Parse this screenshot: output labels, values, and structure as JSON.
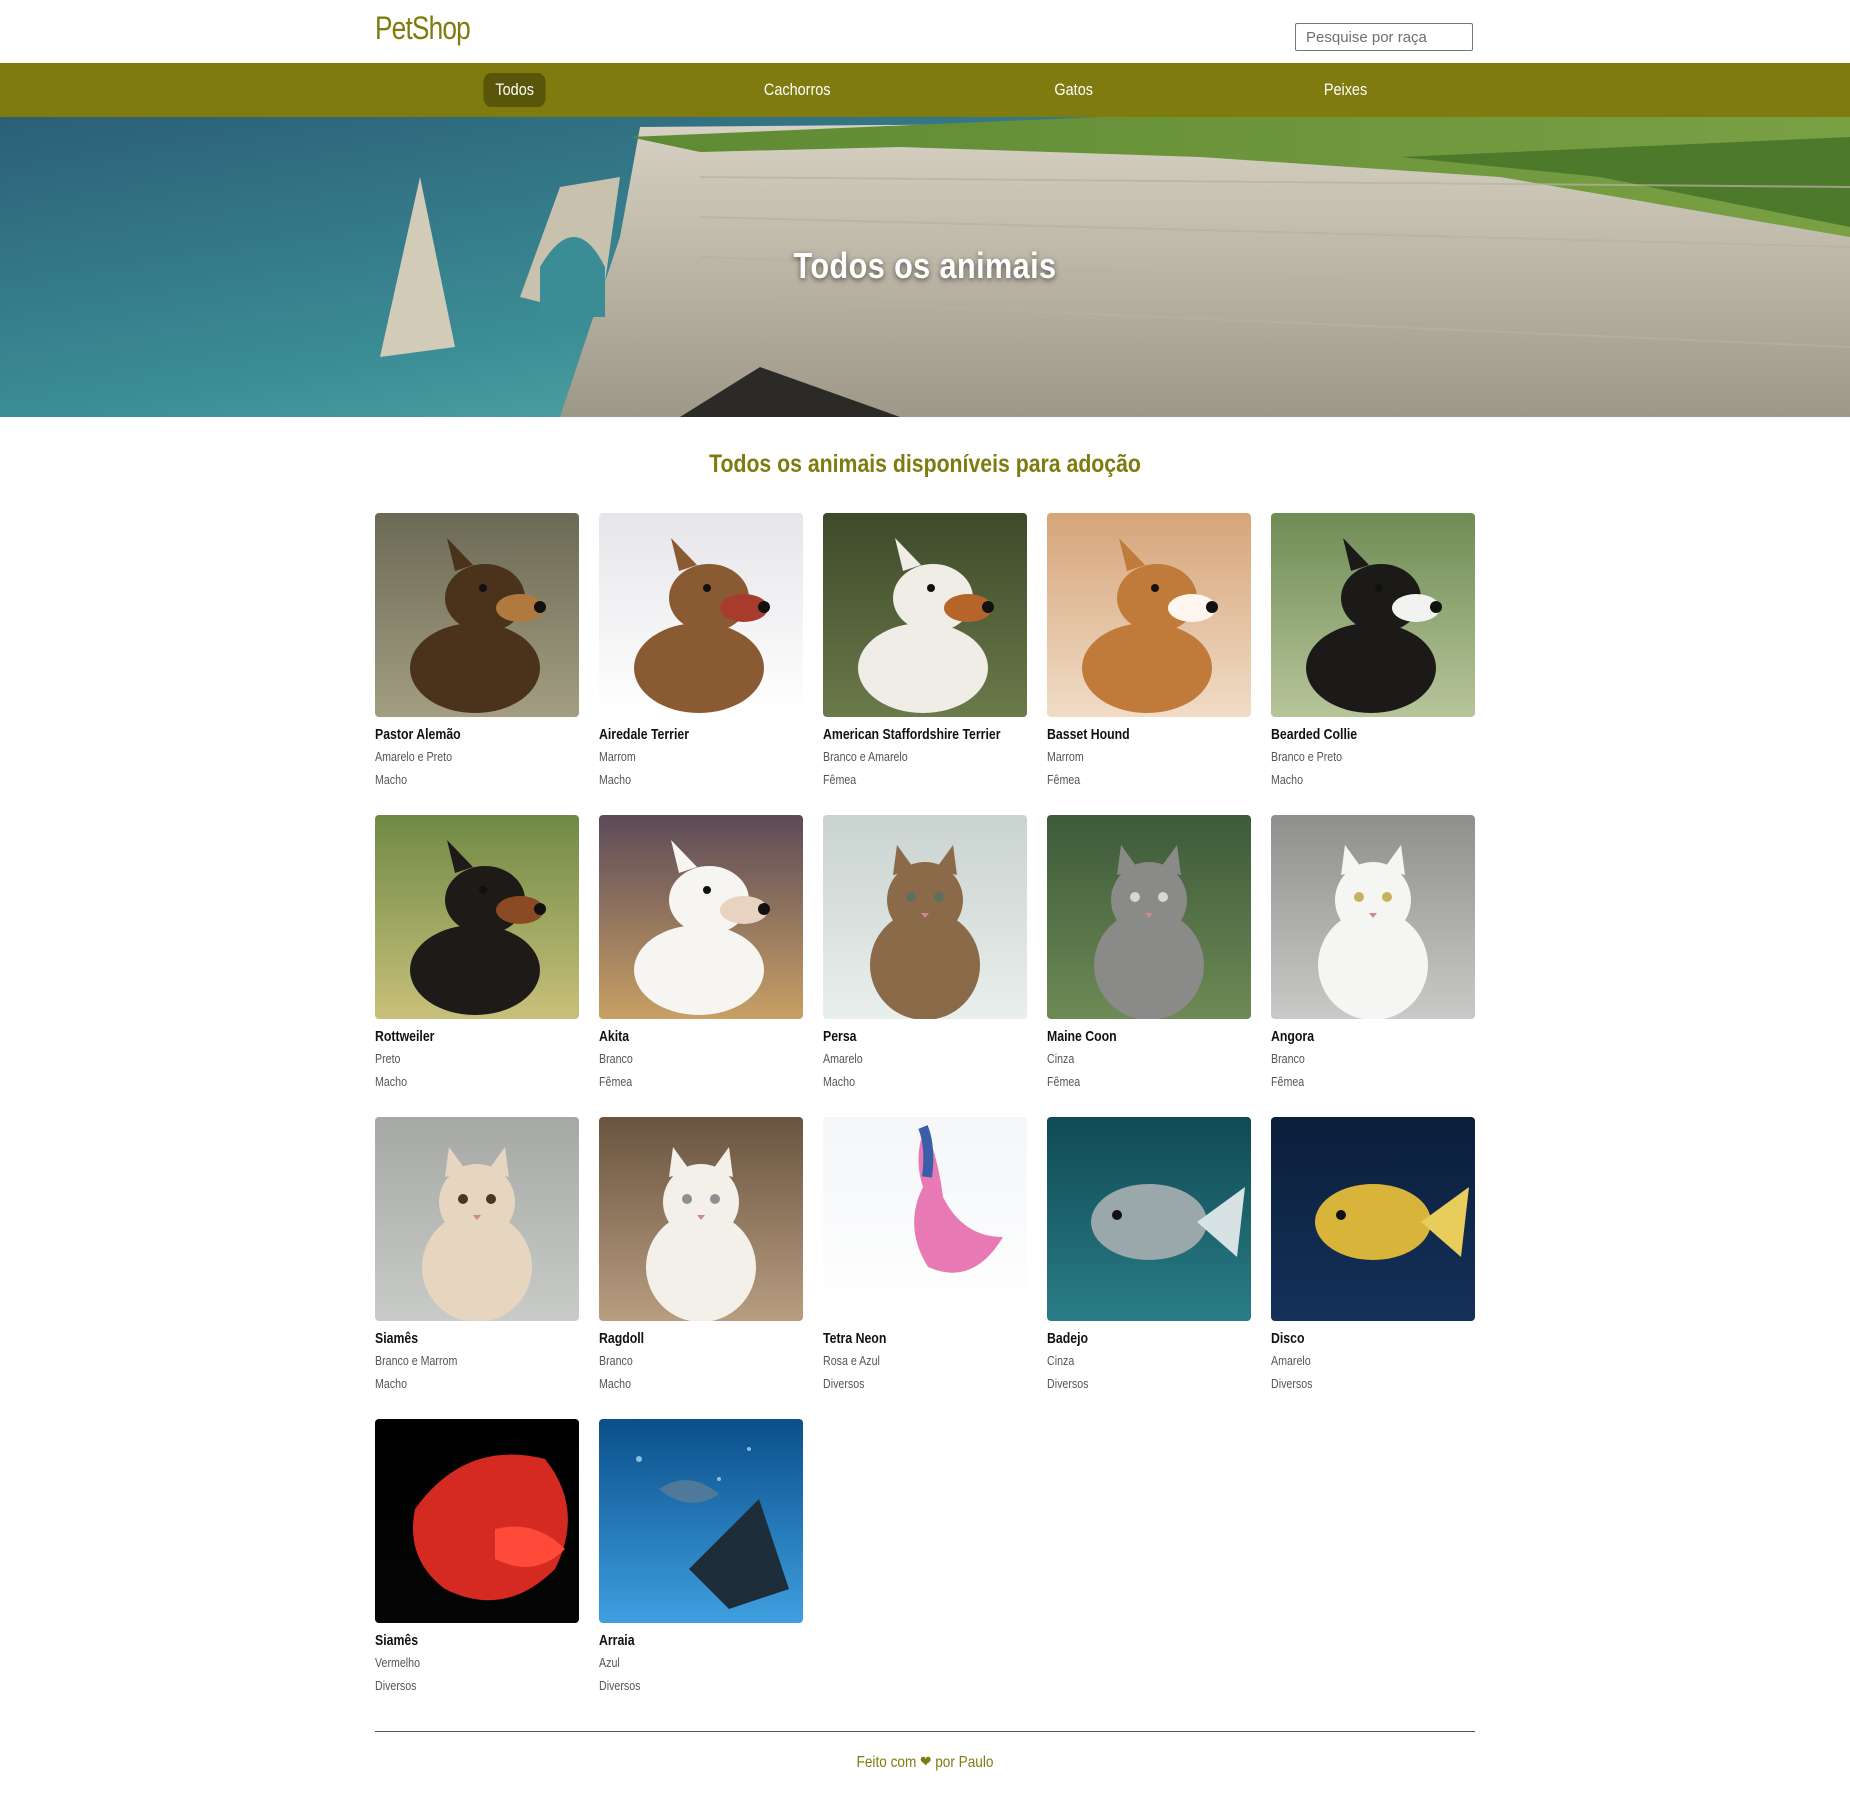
{
  "header": {
    "brand": "PetShop",
    "search_placeholder": "Pesquise por raça"
  },
  "nav": {
    "items": [
      {
        "label": "Todos",
        "active": true
      },
      {
        "label": "Cachorros",
        "active": false
      },
      {
        "label": "Gatos",
        "active": false
      },
      {
        "label": "Peixes",
        "active": false
      }
    ]
  },
  "hero": {
    "title": "Todos os animais"
  },
  "main": {
    "title": "Todos os animais disponíveis para adoção",
    "animals": [
      {
        "name": "Pastor Alemão",
        "color": "Amarelo e Preto",
        "sex": "Macho",
        "photo": "german-shepherd"
      },
      {
        "name": "Airedale Terrier",
        "color": "Marrom",
        "sex": "Macho",
        "photo": "airedale-terrier"
      },
      {
        "name": "American Staffordshire Terrier",
        "color": "Branco e Amarelo",
        "sex": "Fêmea",
        "photo": "staffordshire-terrier"
      },
      {
        "name": "Basset Hound",
        "color": "Marrom",
        "sex": "Fêmea",
        "photo": "basset-hound"
      },
      {
        "name": "Bearded Collie",
        "color": "Branco e Preto",
        "sex": "Macho",
        "photo": "bearded-collie"
      },
      {
        "name": "Rottweiler",
        "color": "Preto",
        "sex": "Macho",
        "photo": "rottweiler"
      },
      {
        "name": "Akita",
        "color": "Branco",
        "sex": "Fêmea",
        "photo": "akita"
      },
      {
        "name": "Persa",
        "color": "Amarelo",
        "sex": "Macho",
        "photo": "persian-cat"
      },
      {
        "name": "Maine Coon",
        "color": "Cinza",
        "sex": "Fêmea",
        "photo": "maine-coon"
      },
      {
        "name": "Angora",
        "color": "Branco",
        "sex": "Fêmea",
        "photo": "angora-cat"
      },
      {
        "name": "Siamês",
        "color": "Branco e Marrom",
        "sex": "Macho",
        "photo": "siamese-cat"
      },
      {
        "name": "Ragdoll",
        "color": "Branco",
        "sex": "Macho",
        "photo": "ragdoll-cat"
      },
      {
        "name": "Tetra Neon",
        "color": "Rosa e Azul",
        "sex": "Diversos",
        "photo": "betta-pink"
      },
      {
        "name": "Badejo",
        "color": "Cinza",
        "sex": "Diversos",
        "photo": "grouper"
      },
      {
        "name": "Disco",
        "color": "Amarelo",
        "sex": "Diversos",
        "photo": "discus-fish"
      },
      {
        "name": "Siamês",
        "color": "Vermelho",
        "sex": "Diversos",
        "photo": "betta-red"
      },
      {
        "name": "Arraia",
        "color": "Azul",
        "sex": "Diversos",
        "photo": "stingray"
      }
    ]
  },
  "footer": {
    "text": "Feito com ❤ por Paulo"
  },
  "colors": {
    "brand": "#7f7b0f",
    "nav_active": "#5a5609"
  }
}
